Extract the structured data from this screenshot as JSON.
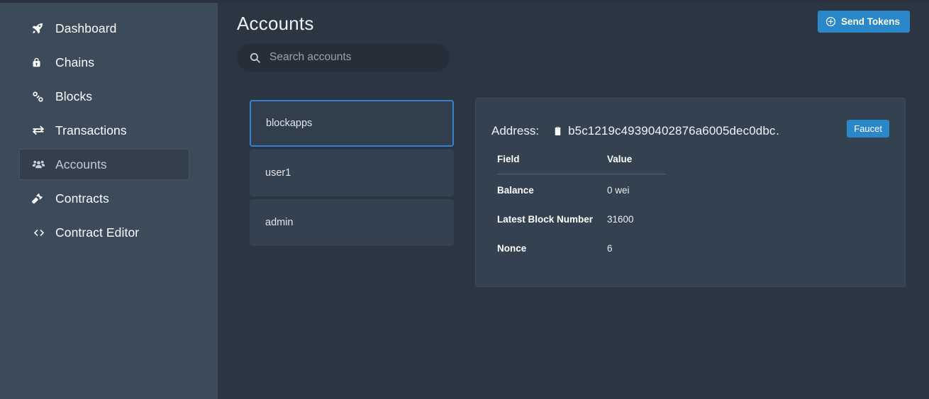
{
  "sidebar": {
    "items": [
      {
        "label": "Dashboard",
        "icon": "rocket-icon",
        "active": false
      },
      {
        "label": "Chains",
        "icon": "lock-icon",
        "active": false
      },
      {
        "label": "Blocks",
        "icon": "link-icon",
        "active": false
      },
      {
        "label": "Transactions",
        "icon": "exchange-arrows-icon",
        "active": false
      },
      {
        "label": "Accounts",
        "icon": "users-icon",
        "active": true
      },
      {
        "label": "Contracts",
        "icon": "gavel-icon",
        "active": false
      },
      {
        "label": "Contract Editor",
        "icon": "code-icon",
        "active": false
      }
    ]
  },
  "header": {
    "title": "Accounts",
    "send_tokens_label": "Send Tokens"
  },
  "search": {
    "placeholder": "Search accounts",
    "value": ""
  },
  "accounts": [
    {
      "name": "blockapps",
      "selected": true
    },
    {
      "name": "user1",
      "selected": false
    },
    {
      "name": "admin",
      "selected": false
    }
  ],
  "detail": {
    "address_label": "Address:",
    "address_value": "b5c1219c49390402876a6005dec0dbc…",
    "faucet_label": "Faucet",
    "table": {
      "columns": [
        "Field",
        "Value"
      ],
      "rows": [
        {
          "field": "Balance",
          "value": "0 wei"
        },
        {
          "field": "Latest Block Number",
          "value": "31600"
        },
        {
          "field": "Nonce",
          "value": "6"
        }
      ]
    }
  },
  "colors": {
    "sidebar_bg": "#3c4b5a",
    "main_bg": "#2b3642",
    "card_bg": "#344150",
    "accent_blue": "#2a87c8",
    "selected_border": "#3b7fd4"
  }
}
